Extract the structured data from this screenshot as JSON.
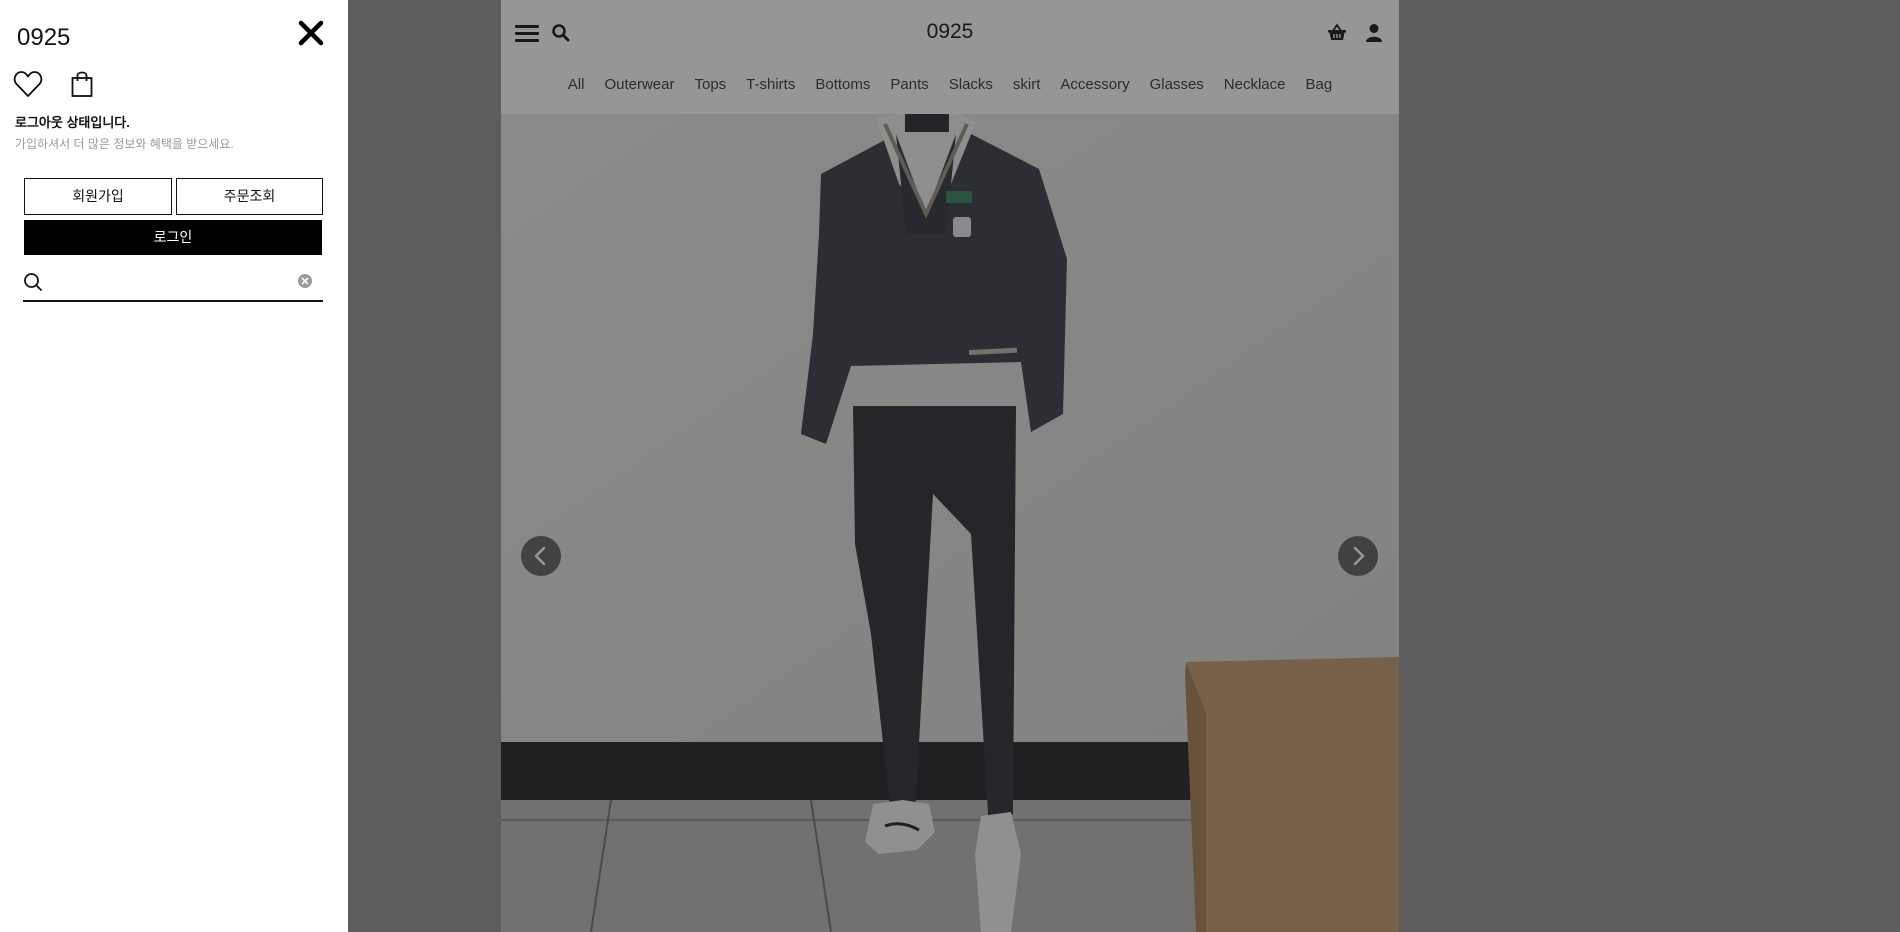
{
  "header": {
    "brand": "0925"
  },
  "categories": [
    "All",
    "Outerwear",
    "Tops",
    "T-shirts",
    "Bottoms",
    "Pants",
    "Slacks",
    "skirt",
    "Accessory",
    "Glasses",
    "Necklace",
    "Bag"
  ],
  "drawer": {
    "title": "0925",
    "status_title": "로그아웃 상태입니다.",
    "status_subtitle": "가입하셔서 더 많은 정보와 혜택을 받으세요.",
    "join_label": "회원가입",
    "order_lookup_label": "주문조회",
    "login_label": "로그인",
    "search_value": ""
  },
  "icons": {
    "menu": "hamburger-icon",
    "search": "search-icon",
    "basket": "basket-icon",
    "user": "user-icon",
    "close": "close-icon",
    "wishlist": "heart-icon",
    "cart": "shopping-bag-icon",
    "clear": "clear-icon",
    "prev": "chevron-left-icon",
    "next": "chevron-right-icon"
  },
  "colors": {
    "overlay": "#232326",
    "login_button_bg": "#000000",
    "text": "#111111",
    "muted_text": "#9a9a9a"
  }
}
